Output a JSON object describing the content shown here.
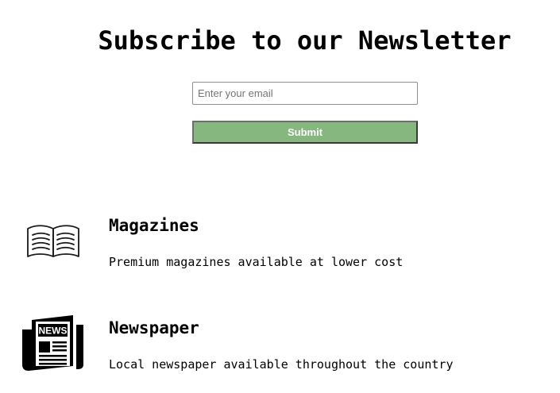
{
  "newsletter": {
    "title": "Subscribe to our Newsletter",
    "email_placeholder": "Enter your email",
    "email_value": "",
    "submit_label": "Submit",
    "submit_color": "#85b77f"
  },
  "features": [
    {
      "icon": "open-book-icon",
      "title": "Magazines",
      "description": "Premium magazines available at lower cost"
    },
    {
      "icon": "newspaper-icon",
      "icon_text": "NEWS",
      "title": "Newspaper",
      "description": "Local newspaper available throughout the country"
    }
  ]
}
